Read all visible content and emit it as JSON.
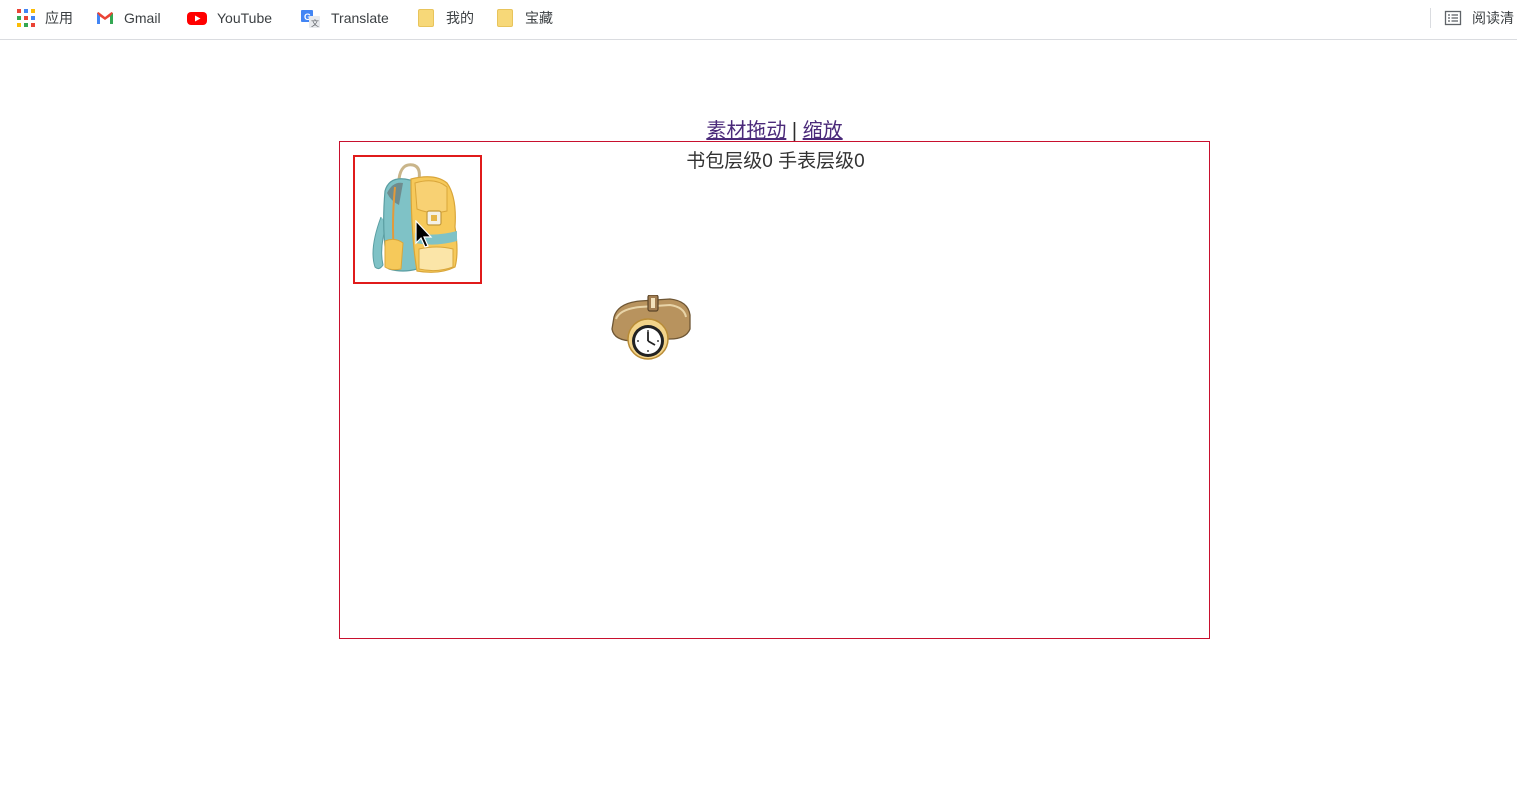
{
  "bookmarks": {
    "apps": {
      "label": "应用",
      "icon": "apps-grid-icon"
    },
    "gmail": {
      "label": "Gmail",
      "icon": "gmail-icon"
    },
    "youtube": {
      "label": "YouTube",
      "icon": "youtube-icon"
    },
    "translate": {
      "label": "Translate",
      "icon": "translate-icon"
    },
    "mine": {
      "label": "我的",
      "icon": "folder-icon"
    },
    "treasure": {
      "label": "宝藏",
      "icon": "folder-icon"
    },
    "reading_list": {
      "label": "阅读清",
      "icon": "reading-list-icon"
    }
  },
  "nav": {
    "drag_link": "素材拖动",
    "separator": "|",
    "zoom_link": "缩放"
  },
  "stage": {
    "level_text": "书包层级0 手表层级0",
    "items": [
      {
        "name": "backpack",
        "selected": true
      },
      {
        "name": "watch",
        "selected": false
      }
    ]
  },
  "colors": {
    "stage_border": "#c8102e",
    "selection_border": "#e01b1b",
    "link": "#4b2a7a"
  }
}
